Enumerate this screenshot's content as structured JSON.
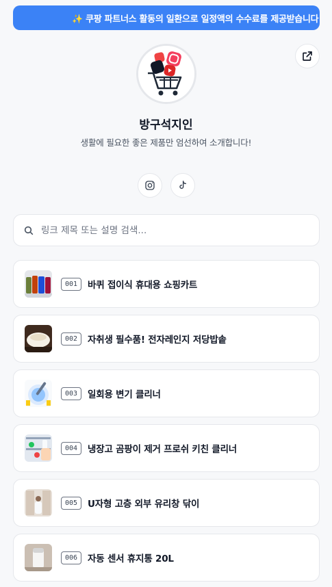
{
  "banner": {
    "text": "✨ 쿠팡 파트너스 활동의 일환으로 일정액의 수수료를 제공받습니다 ✨"
  },
  "profile": {
    "name": "방구석지인",
    "description": "생활에 필요한 좋은 제품만 엄선하여 소개합니다!"
  },
  "search": {
    "placeholder": "링크 제목 또는 설명 검색..."
  },
  "links": [
    {
      "number": "001",
      "title": "바퀴 접이식 휴대용 쇼핑카트"
    },
    {
      "number": "002",
      "title": "자취생 필수품! 전자레인지 저당밥솥"
    },
    {
      "number": "003",
      "title": "일회용 변기 클리너"
    },
    {
      "number": "004",
      "title": "냉장고 곰팡이 제거 프로쉬 키친 클리너"
    },
    {
      "number": "005",
      "title": "U자형 고층 외부 유리창 닦이"
    },
    {
      "number": "006",
      "title": "자동 센서 휴지통 20L"
    }
  ],
  "colors": {
    "accent": "#3b82f6",
    "background": "#f7f8fa",
    "card": "#ffffff",
    "border": "#e5e7eb"
  },
  "icons": {
    "share": "external-link-icon",
    "instagram": "instagram-icon",
    "tiktok": "tiktok-icon",
    "search": "search-icon"
  }
}
